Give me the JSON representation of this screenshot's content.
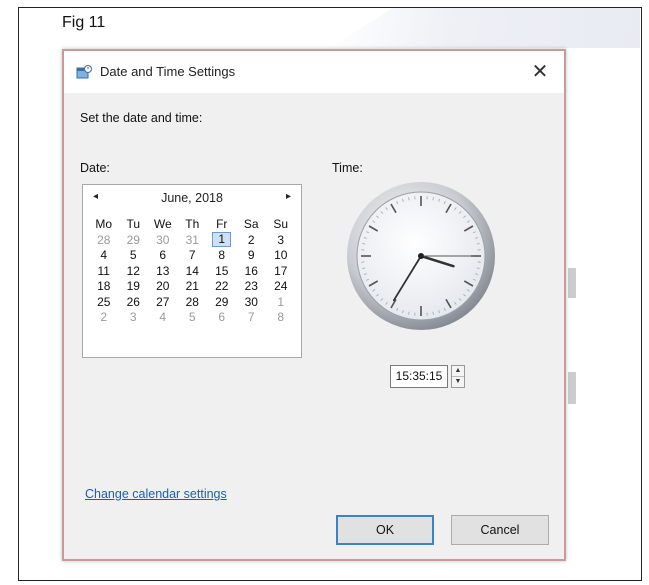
{
  "figure": {
    "label": "Fig 11"
  },
  "dialog": {
    "title": "Date and Time Settings",
    "close_symbol": "✕",
    "heading": "Set the date and time:",
    "date_label": "Date:",
    "time_label": "Time:",
    "link_text": "Change calendar settings",
    "ok_label": "OK",
    "cancel_label": "Cancel"
  },
  "calendar": {
    "prev_symbol": "◂",
    "next_symbol": "▸",
    "month_title": "June, 2018",
    "weekdays": [
      "Mo",
      "Tu",
      "We",
      "Th",
      "Fr",
      "Sa",
      "Su"
    ],
    "weeks": [
      [
        {
          "d": "28",
          "other": true
        },
        {
          "d": "29",
          "other": true
        },
        {
          "d": "30",
          "other": true
        },
        {
          "d": "31",
          "other": true
        },
        {
          "d": "1",
          "selected": true
        },
        {
          "d": "2"
        },
        {
          "d": "3"
        }
      ],
      [
        {
          "d": "4"
        },
        {
          "d": "5"
        },
        {
          "d": "6"
        },
        {
          "d": "7"
        },
        {
          "d": "8"
        },
        {
          "d": "9"
        },
        {
          "d": "10"
        }
      ],
      [
        {
          "d": "11"
        },
        {
          "d": "12"
        },
        {
          "d": "13"
        },
        {
          "d": "14"
        },
        {
          "d": "15"
        },
        {
          "d": "16"
        },
        {
          "d": "17"
        }
      ],
      [
        {
          "d": "18"
        },
        {
          "d": "19"
        },
        {
          "d": "20"
        },
        {
          "d": "21"
        },
        {
          "d": "22"
        },
        {
          "d": "23"
        },
        {
          "d": "24"
        }
      ],
      [
        {
          "d": "25"
        },
        {
          "d": "26"
        },
        {
          "d": "27"
        },
        {
          "d": "28"
        },
        {
          "d": "29"
        },
        {
          "d": "30"
        },
        {
          "d": "1",
          "other": true
        }
      ],
      [
        {
          "d": "2",
          "other": true
        },
        {
          "d": "3",
          "other": true
        },
        {
          "d": "4",
          "other": true
        },
        {
          "d": "5",
          "other": true
        },
        {
          "d": "6",
          "other": true
        },
        {
          "d": "7",
          "other": true
        },
        {
          "d": "8",
          "other": true
        }
      ]
    ]
  },
  "time": {
    "value": "15:35:15",
    "spin_up": "▲",
    "spin_down": "▼",
    "clock": {
      "hours": 15,
      "minutes": 35,
      "seconds": 15
    }
  },
  "icons": {
    "title_icon": "calendar-clock-icon",
    "close": "close-icon",
    "prev": "chevron-left-icon",
    "next": "chevron-right-icon"
  },
  "colors": {
    "link": "#1a5fb0",
    "dialog_border": "#c89a9a",
    "ok_border": "#3c82c8",
    "selected_day": "#cde0f4"
  }
}
